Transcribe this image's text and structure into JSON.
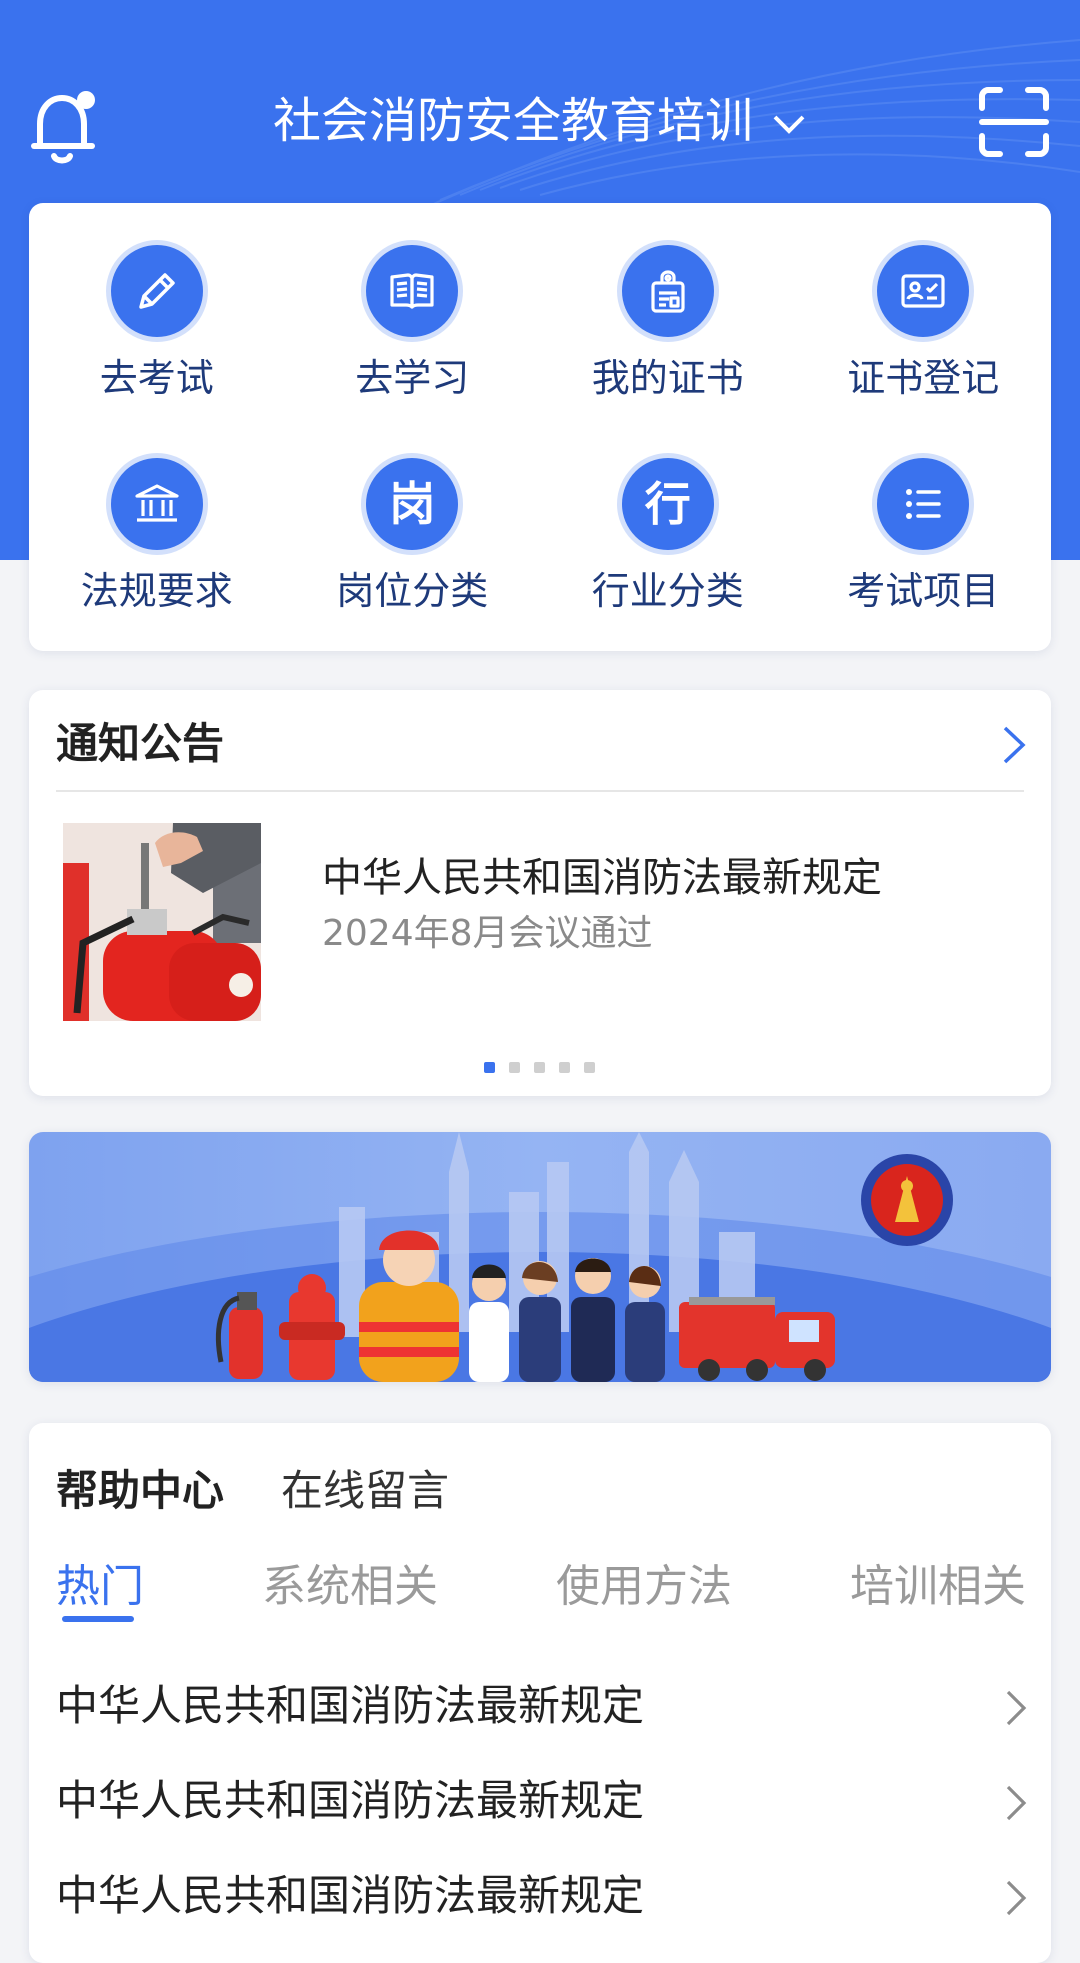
{
  "header": {
    "title": "社会消防安全教育培训",
    "bell_icon": "bell-icon",
    "scan_icon": "scan-icon",
    "dropdown_icon": "chevron-down-icon"
  },
  "quick_menu": {
    "items": [
      {
        "label": "去考试",
        "icon": "pencil-icon"
      },
      {
        "label": "去学习",
        "icon": "book-icon"
      },
      {
        "label": "我的证书",
        "icon": "badge-icon"
      },
      {
        "label": "证书登记",
        "icon": "id-card-icon"
      },
      {
        "label": "法规要求",
        "icon": "institution-icon"
      },
      {
        "label": "岗位分类",
        "icon": "post-glyph-icon",
        "glyph": "岗"
      },
      {
        "label": "行业分类",
        "icon": "industry-glyph-icon",
        "glyph": "行"
      },
      {
        "label": "考试项目",
        "icon": "list-icon"
      }
    ]
  },
  "notice": {
    "heading": "通知公告",
    "news_title": "中华人民共和国消防法最新规定",
    "news_subtitle": "2024年8月会议通过",
    "carousel_pages": 5,
    "carousel_active": 1
  },
  "help": {
    "heading": "帮助中心",
    "heading_alt": "在线留言",
    "tabs": [
      "热门",
      "系统相关",
      "使用方法",
      "培训相关"
    ],
    "active_tab": 0,
    "questions": [
      "中华人民共和国消防法最新规定",
      "中华人民共和国消防法最新规定",
      "中华人民共和国消防法最新规定"
    ]
  },
  "colors": {
    "brand_blue": "#3a72ee",
    "menu_label": "#1e3a7a",
    "background": "#f3f4f7"
  }
}
